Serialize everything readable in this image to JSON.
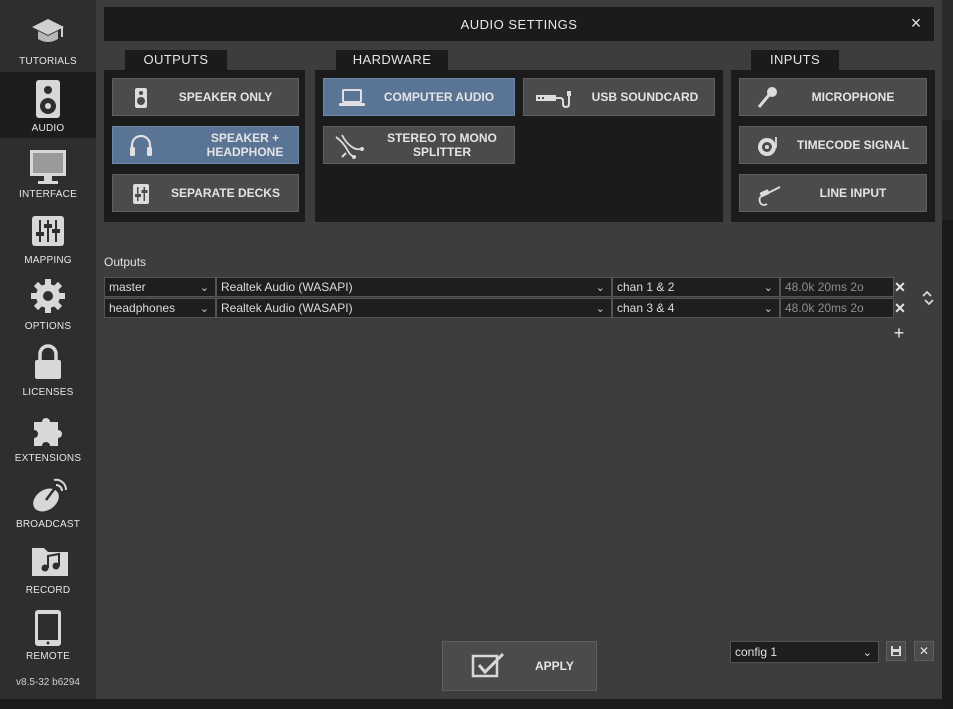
{
  "sidebar": {
    "items": [
      {
        "label": "TUTORIALS",
        "icon": "graduation-cap-icon"
      },
      {
        "label": "AUDIO",
        "icon": "speaker-icon",
        "active": true
      },
      {
        "label": "INTERFACE",
        "icon": "monitor-icon"
      },
      {
        "label": "MAPPING",
        "icon": "sliders-icon"
      },
      {
        "label": "OPTIONS",
        "icon": "gear-icon"
      },
      {
        "label": "LICENSES",
        "icon": "lock-icon"
      },
      {
        "label": "EXTENSIONS",
        "icon": "puzzle-icon"
      },
      {
        "label": "BROADCAST",
        "icon": "satellite-dish-icon"
      },
      {
        "label": "RECORD",
        "icon": "music-folder-icon"
      },
      {
        "label": "REMOTE",
        "icon": "tablet-icon"
      }
    ],
    "version": "v8.5-32 b6294"
  },
  "window": {
    "title": "AUDIO SETTINGS",
    "close": "×"
  },
  "outputs_group": {
    "tab": "OUTPUTS",
    "buttons": [
      {
        "label": "SPEAKER ONLY",
        "icon": "speaker-icon",
        "selected": false
      },
      {
        "label": "SPEAKER + HEADPHONE",
        "icon": "headphones-icon",
        "selected": true
      },
      {
        "label": "SEPARATE DECKS",
        "icon": "mixer-icon",
        "selected": false
      }
    ]
  },
  "hardware_group": {
    "tab": "HARDWARE",
    "buttons": [
      {
        "label": "COMPUTER AUDIO",
        "icon": "laptop-icon",
        "selected": true
      },
      {
        "label": "USB SOUNDCARD",
        "icon": "usb-soundcard-icon",
        "selected": false
      },
      {
        "label": "STEREO TO MONO SPLITTER",
        "icon": "splitter-cable-icon",
        "selected": false
      }
    ]
  },
  "inputs_group": {
    "tab": "INPUTS",
    "buttons": [
      {
        "label": "MICROPHONE",
        "icon": "microphone-icon",
        "selected": false
      },
      {
        "label": "TIMECODE SIGNAL",
        "icon": "turntable-icon",
        "selected": false
      },
      {
        "label": "LINE INPUT",
        "icon": "jack-cable-icon",
        "selected": false
      }
    ]
  },
  "outputs_table": {
    "label": "Outputs",
    "rows": [
      {
        "channel": "master",
        "device": "Realtek Audio (WASAPI)",
        "chan": "chan 1 & 2",
        "format": "48.0k 20ms 2o"
      },
      {
        "channel": "headphones",
        "device": "Realtek Audio (WASAPI)",
        "chan": "chan 3 & 4",
        "format": "48.0k 20ms 2o"
      }
    ],
    "delete": "✕",
    "add": "+"
  },
  "footer": {
    "apply_label": "APPLY",
    "config_value": "config 1",
    "save_icon": "save-icon",
    "delete_icon": "close-icon",
    "delete_glyph": "✕"
  },
  "colors": {
    "selected_button": "#5a7496",
    "button": "#4b4b4e",
    "panel": "#1b1b1c",
    "window": "#3d3d3f"
  }
}
